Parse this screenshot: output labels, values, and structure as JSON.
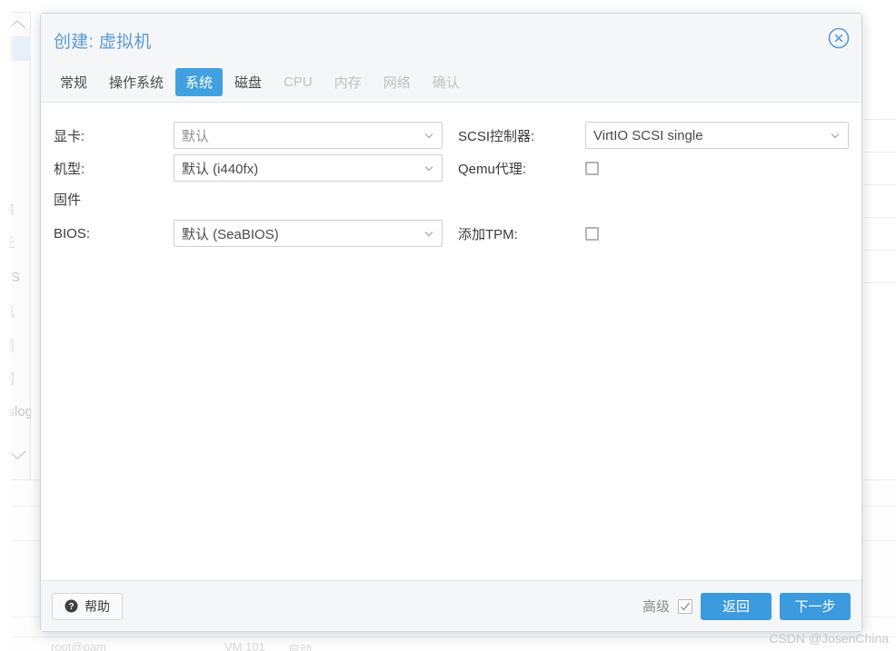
{
  "background": {
    "sidebar_items": [
      "络",
      "证",
      "NS",
      "机",
      "项",
      "间",
      "yslog"
    ],
    "bottom_items": [
      "root@pam",
      "VM 101",
      "启动"
    ]
  },
  "dialog": {
    "title": "创建: 虚拟机",
    "close_icon": "close-circle-icon",
    "tabs": [
      {
        "label": "常规",
        "state": "enabled"
      },
      {
        "label": "操作系统",
        "state": "enabled"
      },
      {
        "label": "系统",
        "state": "active"
      },
      {
        "label": "磁盘",
        "state": "enabled"
      },
      {
        "label": "CPU",
        "state": "disabled"
      },
      {
        "label": "内存",
        "state": "disabled"
      },
      {
        "label": "网络",
        "state": "disabled"
      },
      {
        "label": "确认",
        "state": "disabled"
      }
    ],
    "left_column": {
      "graphic_card_label": "显卡:",
      "graphic_card_value": "默认",
      "machine_label": "机型:",
      "machine_value": "默认 (i440fx)",
      "firmware_section": "固件",
      "bios_label": "BIOS:",
      "bios_value": "默认 (SeaBIOS)"
    },
    "right_column": {
      "scsi_label": "SCSI控制器:",
      "scsi_value": "VirtIO SCSI single",
      "qemu_agent_label": "Qemu代理:",
      "qemu_agent_checked": false,
      "tpm_label": "添加TPM:",
      "tpm_checked": false
    },
    "footer": {
      "help_label": "帮助",
      "help_icon": "question-circle-icon",
      "advanced_label": "高级",
      "advanced_checked": true,
      "back_label": "返回",
      "next_label": "下一步"
    },
    "colors": {
      "accent_blue": "#3c9ade",
      "title_blue": "#5b9bd5",
      "header_gray": "#f5f6f7"
    }
  },
  "watermark": "CSDN @JosenChina"
}
